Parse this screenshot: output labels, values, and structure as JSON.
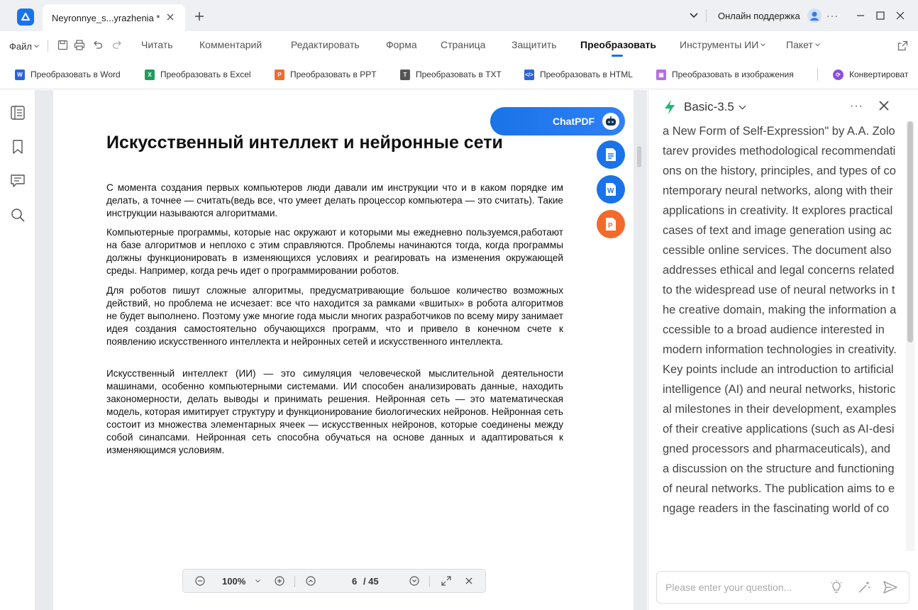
{
  "titlebar": {
    "tab_title": "Neyronnye_s...yrazhenia *",
    "support_label": "Онлайн поддержка",
    "more_label": "···"
  },
  "menubar": {
    "file_label": "Файл",
    "items": [
      "Читать",
      "Комментарий",
      "Редактировать",
      "Форма",
      "Страница",
      "Защитить",
      "Преобразовать",
      "Инструменты ИИ",
      "Пакет"
    ],
    "active": "Преобразовать"
  },
  "convert_bar": {
    "items": [
      {
        "label": "Преобразовать в Word",
        "icon": "word-icon",
        "color": "#2b64d8"
      },
      {
        "label": "Преобразовать в Excel",
        "icon": "excel-icon",
        "color": "#1e9e5a"
      },
      {
        "label": "Преобразовать в PPT",
        "icon": "ppt-icon",
        "color": "#f26b2c"
      },
      {
        "label": "Преобразовать в TXT",
        "icon": "txt-icon",
        "color": "#555555"
      },
      {
        "label": "Преобразовать в HTML",
        "icon": "html-icon",
        "color": "#2b64d8"
      },
      {
        "label": "Преобразовать в изображения",
        "icon": "image-icon",
        "color": "#b46ee0"
      },
      {
        "label": "Конвертироват",
        "icon": "convert-icon",
        "color": "#8a4fdc"
      }
    ]
  },
  "document": {
    "title": "Искусственный интеллект и нейронные сети",
    "paragraphs": [
      "С момента создания первых компьютеров люди давали им инструкции что и в каком порядке им делать, а точнее — считать(ведь все, что умеет делать процессор компьютера — это считать). Такие инструкции называются алгоритмами.",
      "Компьютерные программы, которые нас окружают и которыми мы ежедневно пользуемся,работают на базе алгоритмов и неплохо с этим справляются. Проблемы начинаются тогда, когда программы должны функционировать в изменяющихся условиях и реагировать на изменения окружающей среды. Например, когда речь идет о программировании роботов.",
      "Для роботов пишут сложные алгоритмы, предусматривающие большое количество возможных действий, но проблема не исчезает: все что находится за рамками «вшитых» в робота алгоритмов не будет выполнено. Поэтому уже многие года мысли многих разработчиков по всему миру занимает идея создания самостоятельно обучающихся программ, что и привело в конечном счете к появлению искусственного интеллекта и нейронных сетей и искусственного интеллекта.",
      "Искусственный интеллект (ИИ) — это симуляция человеческой мыслительной деятельности машинами, особенно компьютерными системами. ИИ способен анализировать данные, находить закономерности, делать выводы и принимать решения. Нейронная сеть — это математическая модель, которая имитирует структуру и функционирование биологических нейронов. Нейронная сеть состоит из множества элементарных ячеек — искусственных нейронов, которые соединены между собой синапсами. Нейронная сеть способна обучаться на основе данных и адаптироваться к изменяющимся условиям."
    ]
  },
  "chatpdf": {
    "label": "ChatPDF"
  },
  "zoombar": {
    "zoom": "100%",
    "page": "6",
    "total": "/ 45"
  },
  "ai_panel": {
    "model": "Basic-3.5",
    "summary": "a New Form of Self-Expression\" by A.A. Zolotarev provides methodological recommendations on the history, principles, and types of contemporary neural networks, along with their applications in creativity. It explores practical cases of text and image generation using accessible online services. The document also addresses ethical and legal concerns related to the widespread use of neural networks in the creative domain, making the information accessible to a broad audience interested in modern information technologies in creativity. Key points include an introduction to artificial intelligence (AI) and neural networks, historical milestones in their development, examples of their creative applications (such as AI-designed processors and pharmaceuticals), and a discussion on the structure and functioning of neural networks. The publication aims to engage readers in the fascinating world of co",
    "placeholder": "Please enter your question..."
  },
  "colors": {
    "accent": "#1a73e8",
    "ppt_fab": "#f26b2c",
    "word": "#2b64d8",
    "excel": "#1e9e5a"
  }
}
